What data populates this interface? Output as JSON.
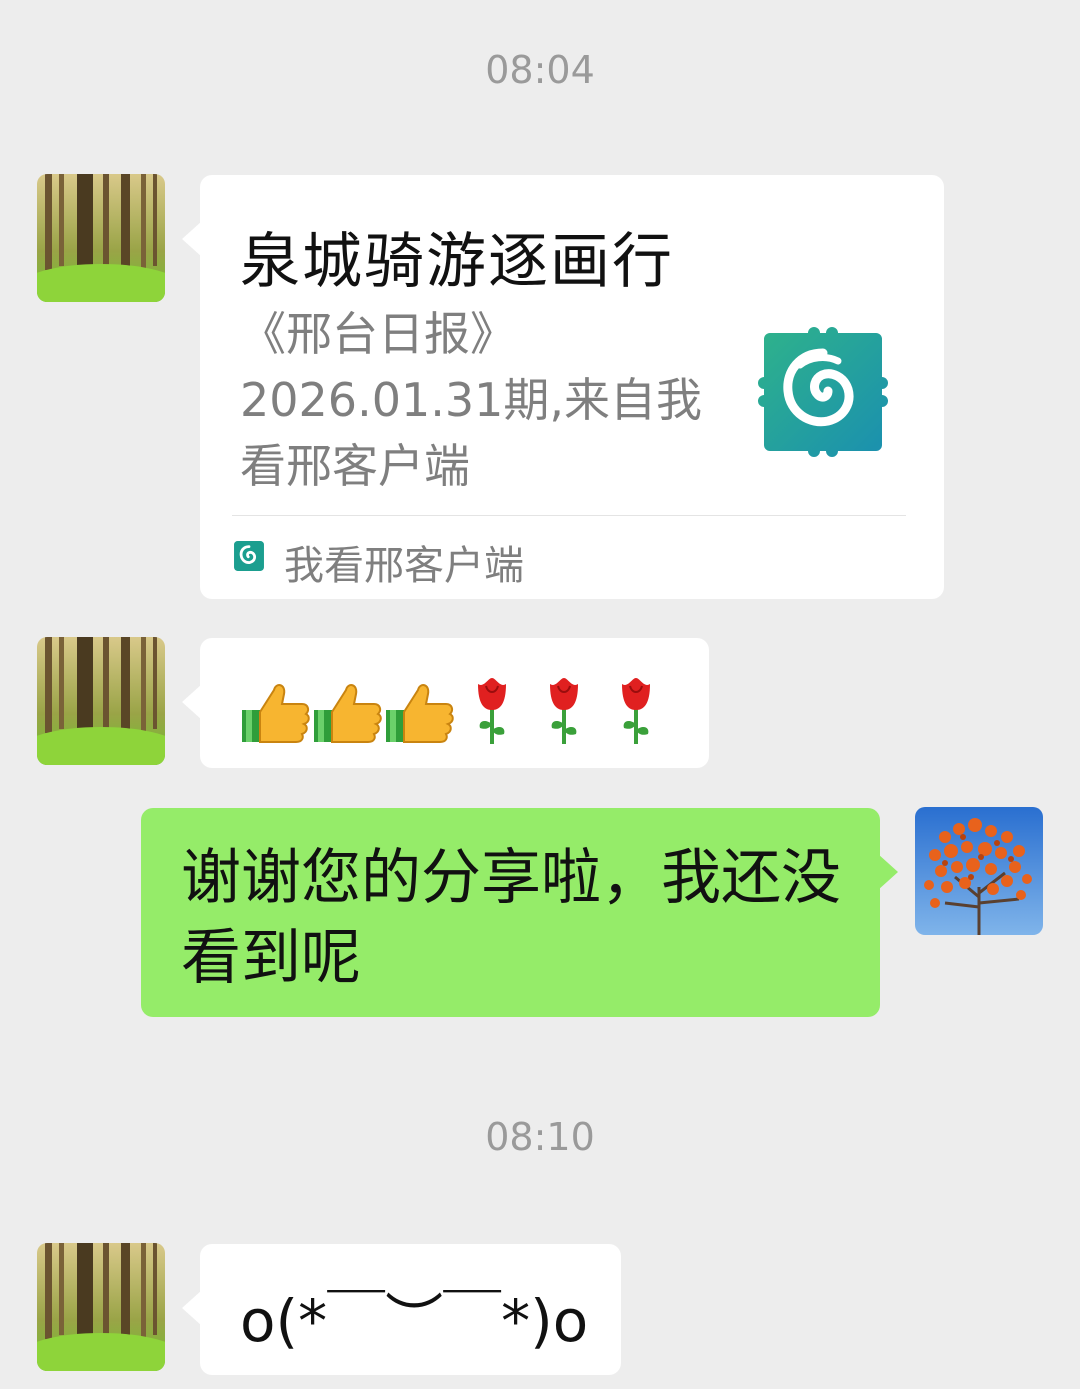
{
  "timestamps": [
    "08:04",
    "08:10"
  ],
  "messages": {
    "link_card": {
      "title": "泉城骑游逐画行",
      "description": "《邢台日报》2026.01.31期,来自我看邢客户端",
      "source": "我看邢客户端",
      "thumbnail_icon": "app-logo-icon",
      "brand_color": "#1b9e8f"
    },
    "emoji_message": {
      "emojis": [
        "thumbs-up-icon",
        "thumbs-up-icon",
        "thumbs-up-icon",
        "rose-icon",
        "rose-icon",
        "rose-icon"
      ]
    },
    "reply": {
      "text": "谢谢您的分享啦，我还没看到呢"
    },
    "kaomoji": {
      "text": "o(*￣︶￣*)o"
    }
  },
  "avatars": {
    "contact": "forest-avatar",
    "self": "persimmon-tree-avatar"
  },
  "colors": {
    "background": "#ededed",
    "incoming_bubble": "#ffffff",
    "outgoing_bubble": "#95ec69",
    "timestamp": "#9a9a9a"
  }
}
